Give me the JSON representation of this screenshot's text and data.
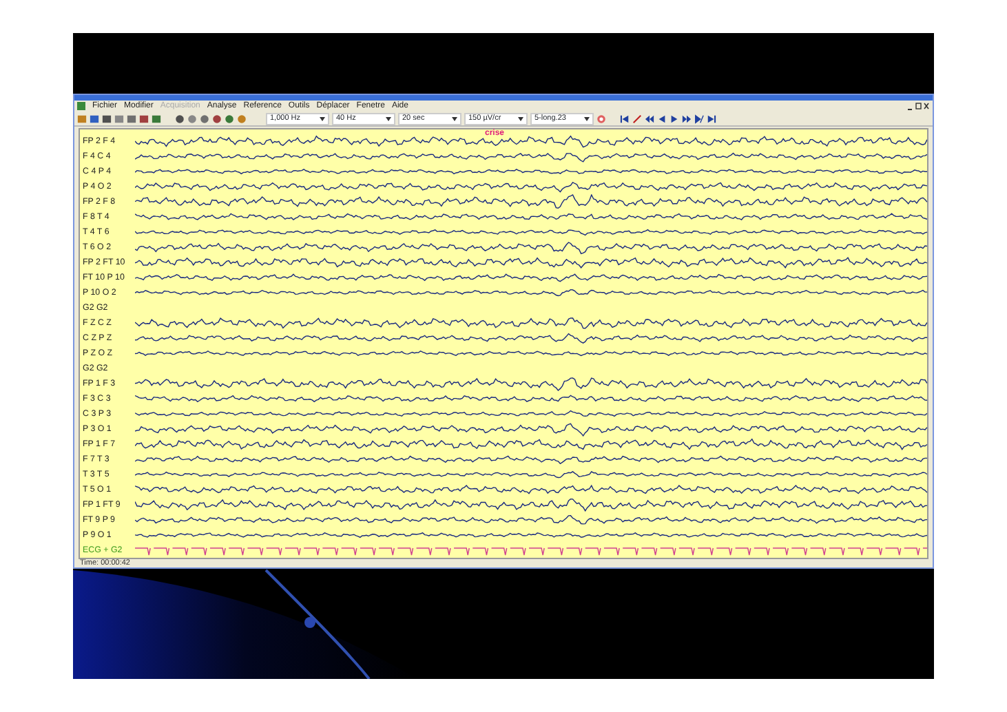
{
  "menu": [
    {
      "label": "Fichier",
      "disabled": false
    },
    {
      "label": "Modifier",
      "disabled": false
    },
    {
      "label": "Acquisition",
      "disabled": true
    },
    {
      "label": "Analyse",
      "disabled": false
    },
    {
      "label": "Reference",
      "disabled": false
    },
    {
      "label": "Outils",
      "disabled": false
    },
    {
      "label": "Déplacer",
      "disabled": false
    },
    {
      "label": "Fenetre",
      "disabled": false
    },
    {
      "label": "Aide",
      "disabled": false
    }
  ],
  "toolbar": {
    "dropdowns": [
      "1,000 Hz",
      "40 Hz",
      "20 sec",
      "150 µV/cr",
      "5-long.23"
    ]
  },
  "annotation": "crise",
  "channels": [
    {
      "label": "FP 2 F 4",
      "kind": "eeg"
    },
    {
      "label": "F 4 C 4",
      "kind": "eeg"
    },
    {
      "label": "C 4 P 4",
      "kind": "eeg"
    },
    {
      "label": "P 4 O 2",
      "kind": "eeg"
    },
    {
      "label": "FP 2 F 8",
      "kind": "eeg"
    },
    {
      "label": "F 8 T 4",
      "kind": "eeg"
    },
    {
      "label": "T 4 T 6",
      "kind": "eeg"
    },
    {
      "label": "T 6 O 2",
      "kind": "eeg"
    },
    {
      "label": "FP 2 FT 10",
      "kind": "eeg"
    },
    {
      "label": "FT 10 P 10",
      "kind": "eeg"
    },
    {
      "label": "P 10 O 2",
      "kind": "eeg"
    },
    {
      "label": "G2 G2",
      "kind": "flat"
    },
    {
      "label": "F Z C Z",
      "kind": "eeg"
    },
    {
      "label": "C Z P Z",
      "kind": "eeg"
    },
    {
      "label": "P Z O Z",
      "kind": "eeg"
    },
    {
      "label": "G2 G2",
      "kind": "flat"
    },
    {
      "label": "FP 1 F 3",
      "kind": "eeg"
    },
    {
      "label": "F 3 C 3",
      "kind": "eeg"
    },
    {
      "label": "C 3 P 3",
      "kind": "eeg"
    },
    {
      "label": "P 3 O 1",
      "kind": "eeg"
    },
    {
      "label": "FP 1 F 7",
      "kind": "eeg"
    },
    {
      "label": "F 7 T 3",
      "kind": "eeg"
    },
    {
      "label": "T 3 T 5",
      "kind": "eeg"
    },
    {
      "label": "T 5 O 1",
      "kind": "eeg"
    },
    {
      "label": "FP 1 FT 9",
      "kind": "eeg"
    },
    {
      "label": "FT 9 P 9",
      "kind": "eeg"
    },
    {
      "label": "P 9 O 1",
      "kind": "eeg"
    },
    {
      "label": "ECG + G2",
      "kind": "ecg"
    }
  ],
  "status_bar": "Time: 00:00:42"
}
